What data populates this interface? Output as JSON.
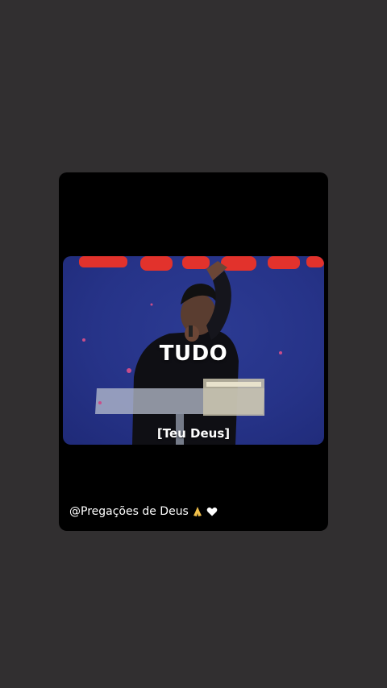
{
  "story": {
    "video": {
      "caption_main": "TUDO",
      "caption_sub": "[Teu Deus]"
    },
    "credit": {
      "handle": "@Pregações de Deus",
      "icons": [
        "pray-icon",
        "white-heart-icon"
      ]
    }
  },
  "colors": {
    "background": "#312f30",
    "card": "#000000",
    "stage_blue": "#263388",
    "banner_red": "#e2322c"
  }
}
